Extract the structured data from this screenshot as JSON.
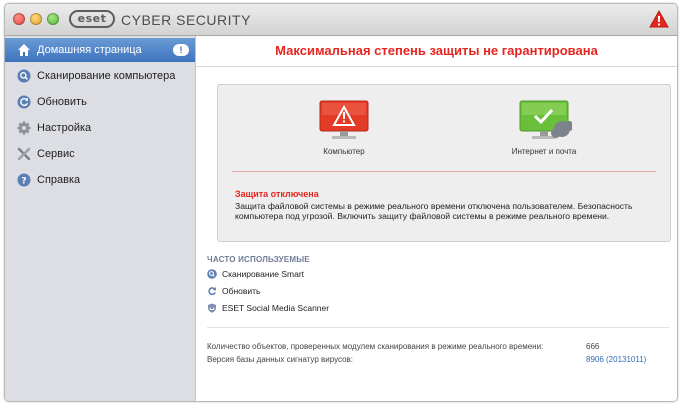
{
  "app": {
    "logo_text": "eset",
    "title": "CYBER SECURITY"
  },
  "sidebar": {
    "items": [
      {
        "label": "Домашняя страница",
        "badge": "!",
        "active": true
      },
      {
        "label": "Сканирование компьютера"
      },
      {
        "label": "Обновить"
      },
      {
        "label": "Настройка"
      },
      {
        "label": "Сервис"
      },
      {
        "label": "Справка"
      }
    ]
  },
  "banner": {
    "text": "Максимальная степень защиты не гарантирована"
  },
  "status": {
    "computer_label": "Компьютер",
    "internet_label": "Интернет и почта",
    "warning_title": "Защита отключена",
    "warning_text": "Защита файловой системы в режиме реального времени отключена пользователем. Безопасность компьютера под угрозой. Включить защиту файловой системы в режиме реального времени."
  },
  "faq": {
    "title": "ЧАСТО ИСПОЛЬЗУЕМЫЕ",
    "items": [
      {
        "label": "Сканирование Smart",
        "icon": "search-icon"
      },
      {
        "label": "Обновить",
        "icon": "refresh-icon"
      },
      {
        "label": "ESET Social Media Scanner",
        "icon": "shield-icon"
      }
    ]
  },
  "stats": {
    "objects_label": "Количество объектов, проверенных модулем сканирования в режиме реального времени:",
    "objects_value": "666",
    "db_label": "Версия базы данных сигнатур вирусов:",
    "db_value": "8906 (20131011)"
  },
  "colors": {
    "warning_red": "#e5251f",
    "active_blue": "#3d74be",
    "ok_green": "#6abf3a",
    "link_blue": "#2f6bb8"
  }
}
